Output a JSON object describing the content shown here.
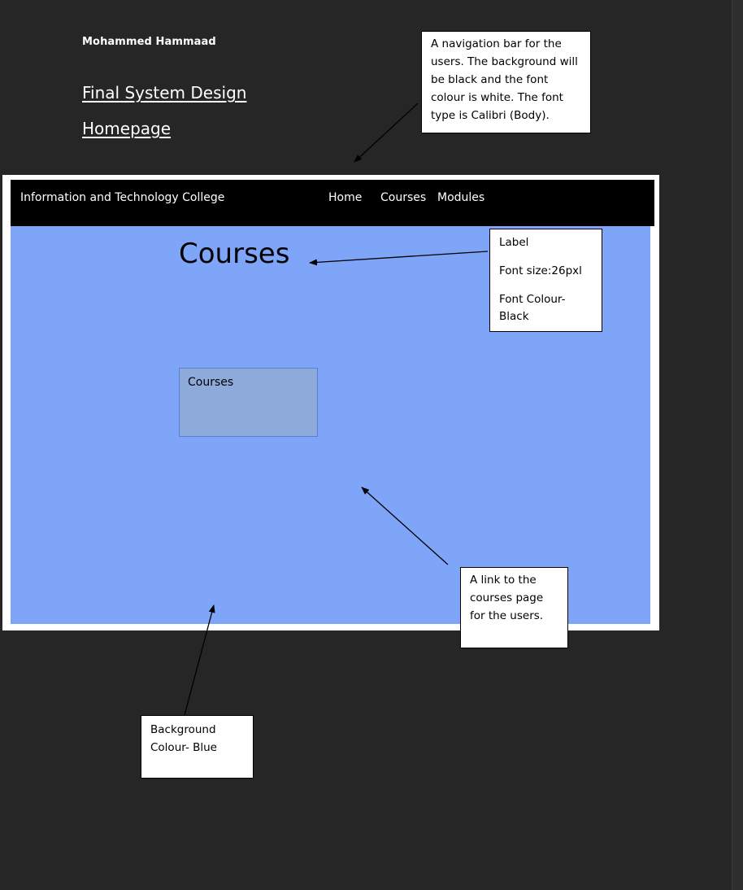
{
  "document": {
    "author": "Mohammed Hammaad",
    "title": "Final System Design",
    "subtitle": "Homepage"
  },
  "mockup": {
    "nav": {
      "brand": "Information and Technology College",
      "links": [
        "Home",
        "Courses",
        "Modules"
      ]
    },
    "page_title": "Courses",
    "course_link_label": "Courses",
    "colors": {
      "nav_background": "#000000",
      "nav_text": "#ffffff",
      "content_background": "#7fa5f8",
      "link_box": "#8eaadb"
    }
  },
  "annotations": {
    "nav_note": "A navigation bar for the users. The background will be black and the font colour is white. The font type is Calibri (Body).",
    "label_note": [
      "Label",
      "Font size:26pxl",
      "Font Colour- Black"
    ],
    "link_note": "A link to the courses page for the users.",
    "background_note": "Background Colour- Blue"
  }
}
